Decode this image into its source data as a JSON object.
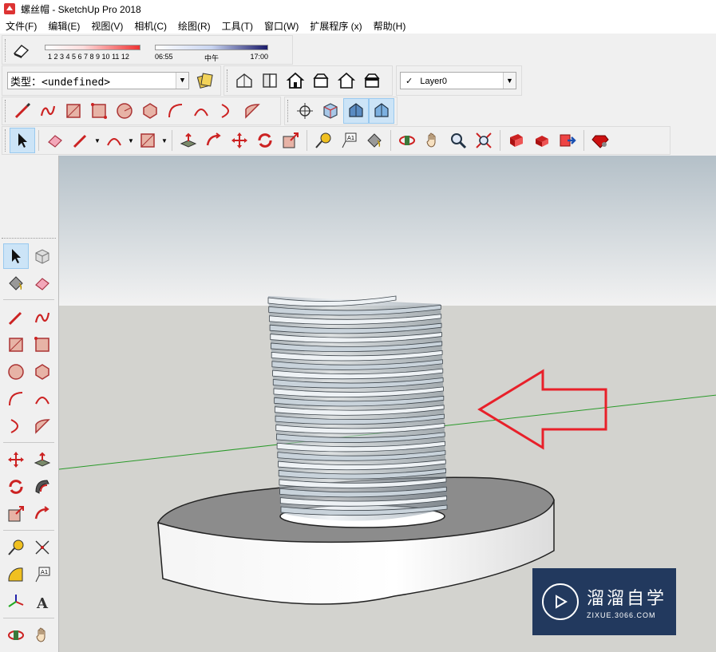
{
  "window": {
    "title": "螺丝帽 - SketchUp Pro 2018"
  },
  "menu": [
    "文件(F)",
    "编辑(E)",
    "视图(V)",
    "相机(C)",
    "绘图(R)",
    "工具(T)",
    "窗口(W)",
    "扩展程序 (x)",
    "帮助(H)"
  ],
  "shadows": {
    "month_labels": "1 2 3 4 5 6 7 8 9 10 11 12",
    "time_start": "06:55",
    "time_mid": "中午",
    "time_end": "17:00"
  },
  "entity_type": {
    "label": "类型：<undefined>"
  },
  "layer": {
    "check": "✓",
    "name": "Layer0"
  },
  "watermark": {
    "name": "溜溜自学",
    "url": "ZIXUE.3066.COM"
  },
  "colors": {
    "sky_top": "#b4c0c8",
    "ground": "#d3d3cf",
    "axis_green": "#2a9a2a",
    "arrow_red": "#e8202a",
    "watermark_bg": "#22395e",
    "accent_red": "#d33"
  }
}
